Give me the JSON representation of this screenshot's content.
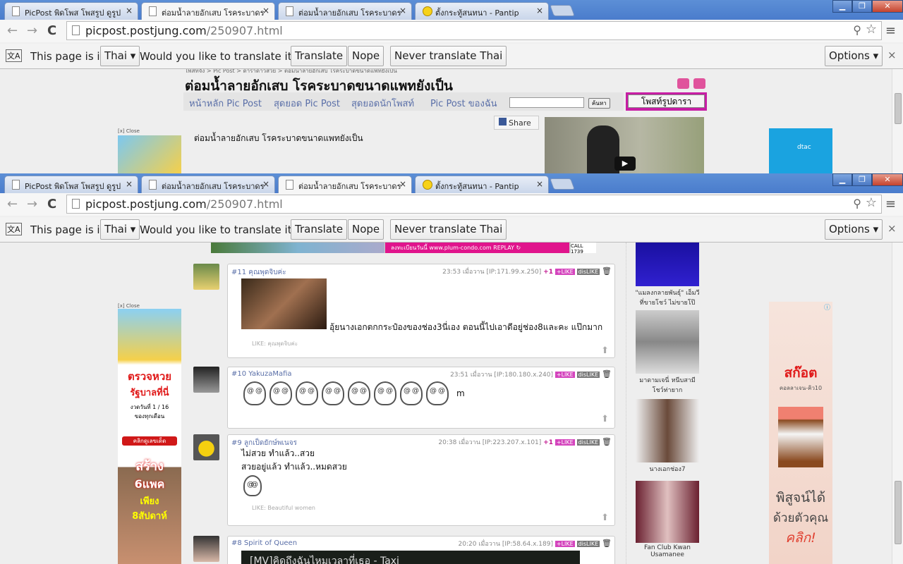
{
  "browser": {
    "tabs": [
      {
        "title": "PicPost พิดโพส โพสรูป ดูรูป"
      },
      {
        "title": "ต่อมน้ำลายอักเสบ โรคระบาดร"
      },
      {
        "title": "ต่อมน้ำลายอักเสบ โรคระบาดร"
      },
      {
        "title": "ตั้งกระทู้สนทนา - Pantip"
      }
    ],
    "close_glyph": "×",
    "url_host": "picpost.postjung.com",
    "url_path": "/250907.html",
    "window_controls": {
      "min": "▁",
      "max": "❐",
      "close": "✕"
    },
    "icons": {
      "back": "←",
      "forward": "→",
      "reload": "C",
      "zoom": "⚲",
      "star": "☆",
      "menu": "≡",
      "translate": "文A"
    }
  },
  "translate_bar": {
    "prefix": "This page is in",
    "language": "Thai ▾",
    "question": "Would you like to translate it?",
    "translate": "Translate",
    "nope": "Nope",
    "never": "Never translate Thai",
    "options": "Options ▾",
    "close": "×"
  },
  "page_top": {
    "breadcrumb": "โพสท์จัง > Pic Post > ดาราดาวสวย > ต่อมน้ำลายอักเสบ โรคระบาดขนาดแพทยังเป็น",
    "title": "ต่อมน้ำลายอักเสบ โรคระบาดขนาดแพทยังเป็น",
    "nav": [
      "หน้าหลัก Pic Post",
      "สุดยอด Pic Post",
      "สุดยอดนักโพสท์",
      "Pic Post ของฉัน"
    ],
    "search_button": "ค้นหา",
    "post_button": "โพสท์รูปดารา",
    "share": "Share",
    "intro": "ต่อมน้ำลายอักเสบ โรคระบาดขนาดแพทยังเป็น",
    "ad_close": "[x] Close",
    "dtac": "dtac"
  },
  "page_bottom": {
    "banner_text": "ลงทะเบียนวันนี้ www.plum-condo.com  REPLAY ↻",
    "banner_call": "CALL 1739",
    "ad_close": "[x] Close",
    "left_ad": [
      "ตรวจหวย",
      "รัฐบาลที่นี่",
      "งวดวันที่ 1 / 16",
      "ของทุกเดือน",
      "คลิกดูเลขเด็ด",
      "สร้าง",
      "6แพค",
      "เพียง",
      "8สัปดาห์"
    ],
    "right_ad": {
      "brand": "สก๊อต",
      "sub": "คอลลาเจน-คิว10",
      "line1": "พิสูจน์ได้",
      "line2": "ด้วยตัวคุณ",
      "cta": "คลิก!"
    },
    "thumbs": [
      {
        "caption": "\"แมลงกลายพันธุ์\" เอ็มวีที่ขายโชว์ ไม่ขายโป๊"
      },
      {
        "caption": "มาดามเจนี่ หนีบสามีโชว์ท่ายาก"
      },
      {
        "caption": "นางเอกช่อง7"
      },
      {
        "caption": "Fan Club Kwan Usamanee"
      }
    ],
    "comments": [
      {
        "num_name": "#11 คุณพุดจิบค่ะ",
        "time": "23:53 เมื่อวาน [IP:171.99.x.250]",
        "plus": "+1",
        "like": "+LIKE",
        "dislike": "disLIKE",
        "text": "อุ้ยนางเอกตกกระป๋องของช่อง3นี่เอง ตอนนี้ไปเอาดีอยู่ช่อง8และคะ แป๊กมาก",
        "likes": "LIKE: คุณพุดจิบค่ะ"
      },
      {
        "num_name": "#10 YakuzaMafia",
        "time": "23:51 เมื่อวาน [IP:180.180.x.240]",
        "like": "+LIKE",
        "dislike": "disLIKE",
        "text": "m"
      },
      {
        "num_name": "#9 ลูกเป็ดยักษ์พเนจร",
        "time": "20:38 เมื่อวาน [IP:223.207.x.101]",
        "plus": "+1",
        "like": "+LIKE",
        "dislike": "disLIKE",
        "line1": "ไม่สวย ทำแล้ว..สวย",
        "line2": "สวยอยู่แล้ว ทำแล้ว..หมดสวย",
        "likes": "LIKE: Beautiful women"
      },
      {
        "num_name": "#8 Spirit of Queen",
        "time": "20:20 เมื่อวาน [IP:58.64.x.189]",
        "like": "+LIKE",
        "dislike": "disLIKE",
        "video_title": "[MV]คิดถึงฉันไหมเวลาที่เธอ - Taxi"
      }
    ]
  }
}
